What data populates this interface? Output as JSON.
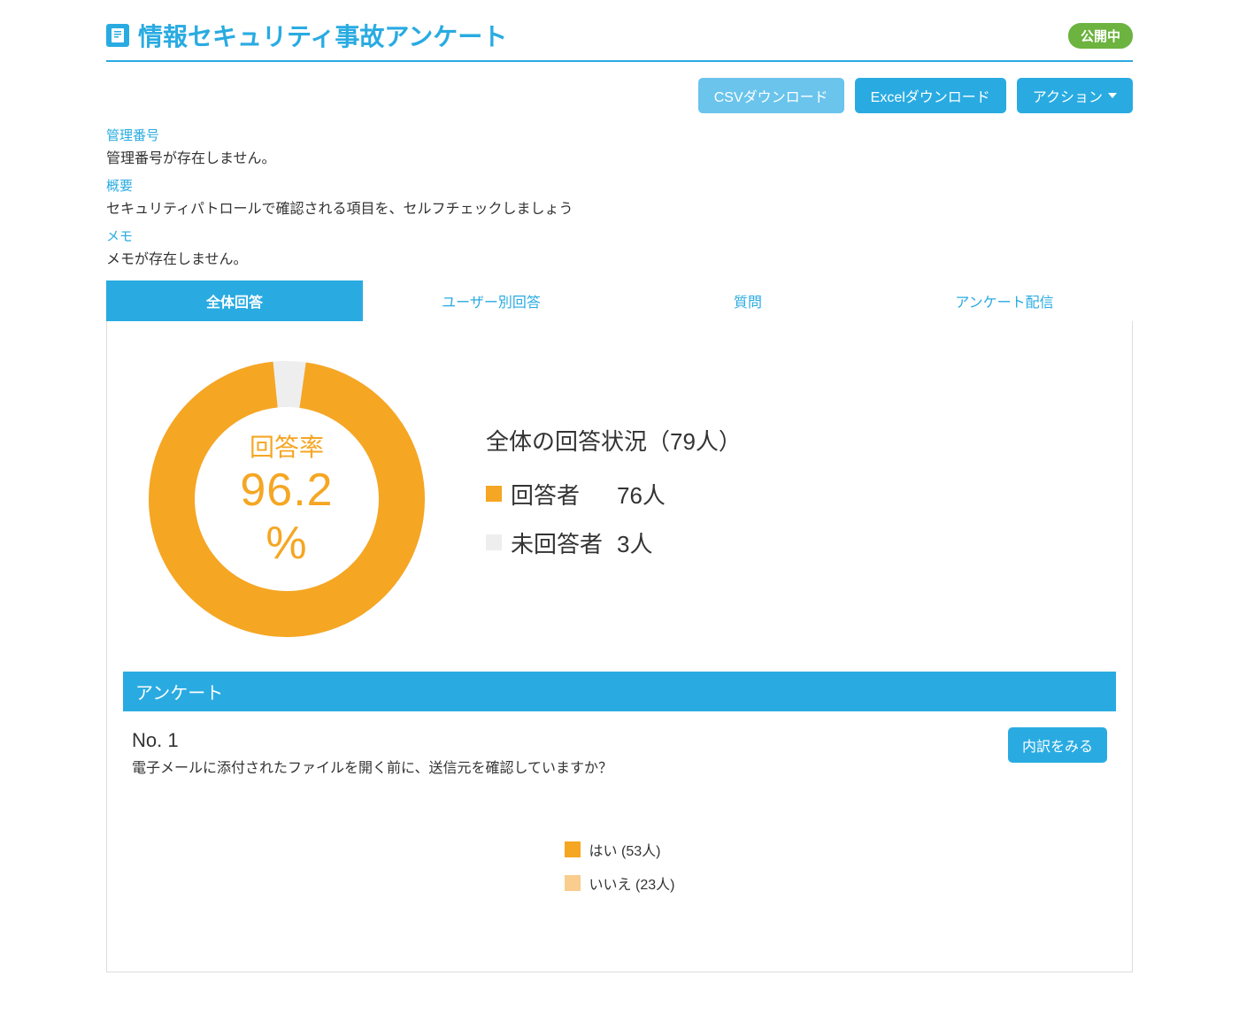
{
  "header": {
    "title": "情報セキュリティ事故アンケート",
    "status_badge": "公開中"
  },
  "buttons": {
    "csv": "CSVダウンロード",
    "excel": "Excelダウンロード",
    "action": "アクション"
  },
  "meta": {
    "control_no_label": "管理番号",
    "control_no_value": "管理番号が存在しません。",
    "summary_label": "概要",
    "summary_value": "セキュリティパトロールで確認される項目を、セルフチェックしましょう",
    "memo_label": "メモ",
    "memo_value": "メモが存在しません。"
  },
  "tabs": {
    "all": "全体回答",
    "by_user": "ユーザー別回答",
    "questions": "質問",
    "distribution": "アンケート配信"
  },
  "overview": {
    "rate_label": "回答率",
    "rate_value": "96.2 %",
    "total_heading": "全体の回答状況（79人）",
    "responders_label": "回答者",
    "responders_count": "76人",
    "non_responders_label": "未回答者",
    "non_responders_count": "3人"
  },
  "section_head": "アンケート",
  "question": {
    "no": "No. 1",
    "text": "電子メールに添付されたファイルを開く前に、送信元を確認していますか？",
    "detail_button": "内訳をみる",
    "legend_yes": "はい (53人)",
    "legend_no": "いいえ (23人)"
  },
  "chart_data": [
    {
      "type": "pie",
      "title": "回答率",
      "series": [
        {
          "name": "回答者",
          "value": 76,
          "color": "#f5a623"
        },
        {
          "name": "未回答者",
          "value": 3,
          "color": "#eeeeee"
        }
      ],
      "center_label": "96.2 %",
      "total": 79
    },
    {
      "type": "pie",
      "title": "No. 1 内訳",
      "series": [
        {
          "name": "はい",
          "value": 53,
          "color": "#f5a623"
        },
        {
          "name": "いいえ",
          "value": 23,
          "color": "#f8cd8e"
        }
      ]
    }
  ]
}
